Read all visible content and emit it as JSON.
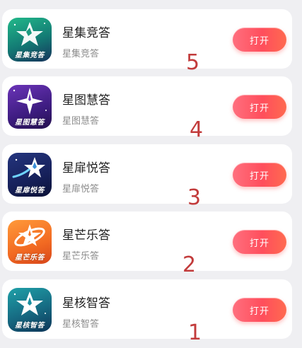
{
  "apps": [
    {
      "name": "星集竞答",
      "subtitle": "星集竞答",
      "icon_caption": "星集竞答",
      "icon": "green-star-icon",
      "icon_colors": [
        "#1fae80",
        "#17375e"
      ],
      "button_label": "打开",
      "rank": "5"
    },
    {
      "name": "星图慧答",
      "subtitle": "星图慧答",
      "icon_caption": "星图慧答",
      "icon": "purple-compass-star-icon",
      "icon_colors": [
        "#5a2b9e",
        "#2d1560"
      ],
      "button_label": "打开",
      "rank": "4"
    },
    {
      "name": "星扉悦答",
      "subtitle": "星扉悦答",
      "icon_caption": "星扉悦答",
      "icon": "navy-shooting-star-icon",
      "icon_colors": [
        "#1d2a6e",
        "#0e1740"
      ],
      "button_label": "打开",
      "rank": "3"
    },
    {
      "name": "星芒乐答",
      "subtitle": "星芒乐答",
      "icon_caption": "星芒乐答",
      "icon": "orange-orbit-star-icon",
      "icon_colors": [
        "#ff8a2a",
        "#e2551a"
      ],
      "button_label": "打开",
      "rank": "2"
    },
    {
      "name": "星核智答",
      "subtitle": "星核智答",
      "icon_caption": "星核智答",
      "icon": "teal-star-icon",
      "icon_colors": [
        "#1c8aa0",
        "#0e3a5c"
      ],
      "button_label": "打开",
      "rank": "1"
    }
  ],
  "colors": {
    "button_gradient_start": "#ff6f7e",
    "button_gradient_end": "#ff6a50",
    "rank_number": "#c23b3b",
    "background": "#efeff2"
  }
}
